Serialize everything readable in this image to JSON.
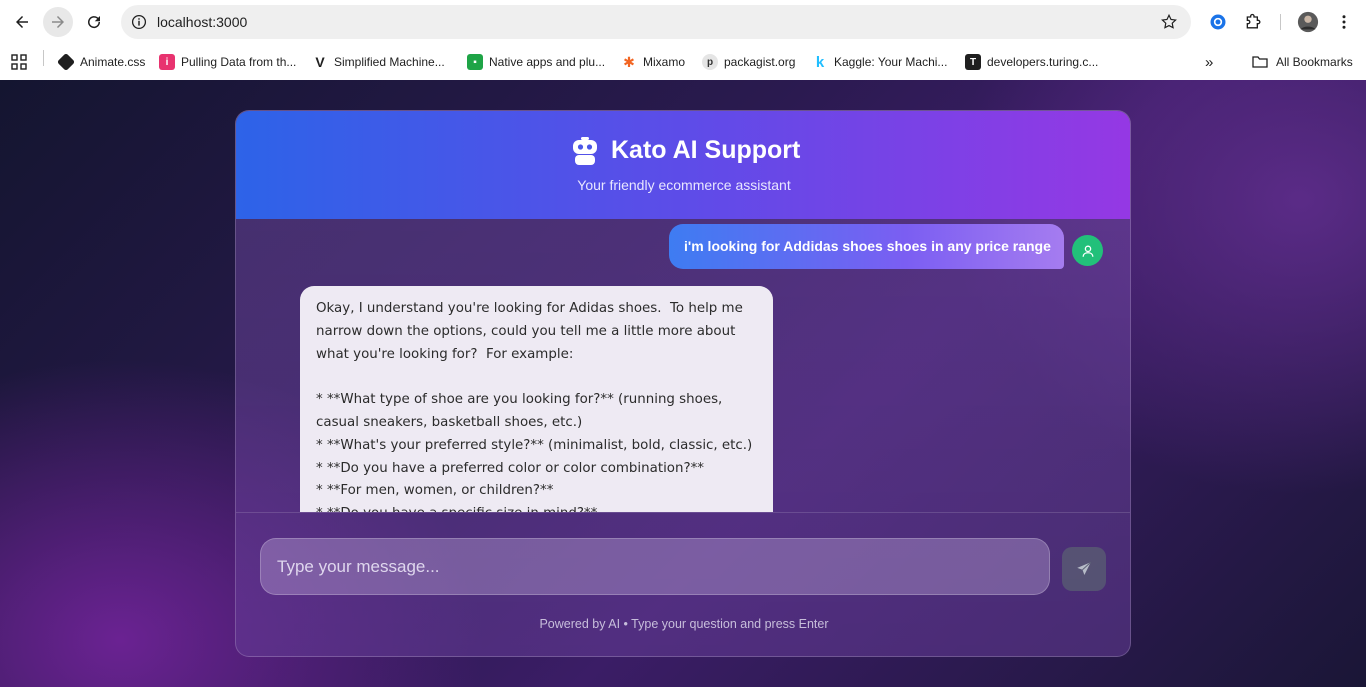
{
  "browser": {
    "url": "localhost:3000",
    "bookmarks": [
      {
        "label": "Animate.css"
      },
      {
        "label": "Pulling Data from th..."
      },
      {
        "label": "Simplified Machine..."
      },
      {
        "label": "Native apps and plu..."
      },
      {
        "label": "Mixamo"
      },
      {
        "label": "packagist.org"
      },
      {
        "label": "Kaggle: Your Machi..."
      },
      {
        "label": "developers.turing.c..."
      }
    ],
    "all_bookmarks_label": "All Bookmarks",
    "more_label": "»"
  },
  "chat": {
    "title": "Kato AI Support",
    "subtitle": "Your friendly ecommerce assistant",
    "messages": [
      {
        "role": "user",
        "text": "i'm looking for Addidas shoes shoes in any price range"
      },
      {
        "role": "assistant",
        "text": "Okay, I understand you're looking for Adidas shoes.  To help me narrow down the options, could you tell me a little more about what you're looking for?  For example:\n\n* **What type of shoe are you looking for?** (running shoes, casual sneakers, basketball shoes, etc.)\n* **What's your preferred style?** (minimalist, bold, classic, etc.)\n* **Do you have a preferred color or color combination?**\n* **For men, women, or children?**\n* **Do you have a specific size in mind?**"
      }
    ],
    "input_placeholder": "Type your message...",
    "footer": "Powered by AI • Type your question and press Enter"
  },
  "colors": {
    "header_start": "#2d63e8",
    "header_end": "#9538e4",
    "user_avatar": "#22c07a"
  }
}
